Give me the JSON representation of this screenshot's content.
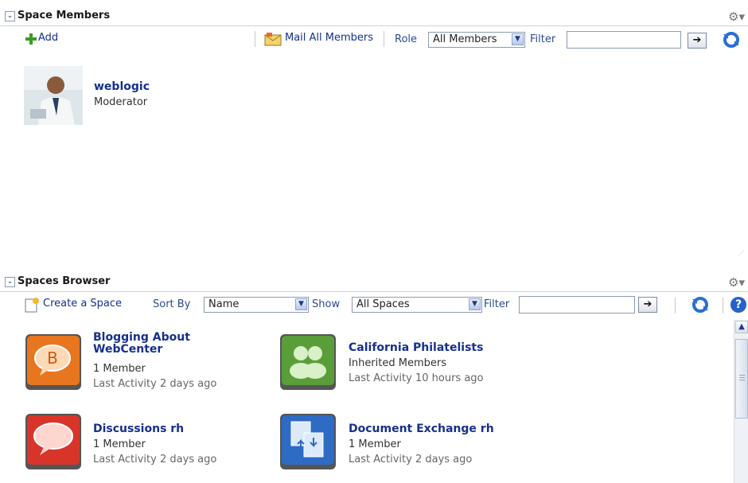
{
  "space_members": {
    "title": "Space Members",
    "add_label": "Add",
    "mail_all_label": "Mail All Members",
    "role_label": "Role",
    "role_selected": "All Members",
    "filter_label": "Filter",
    "filter_value": "",
    "members": [
      {
        "name": "weblogic",
        "role": "Moderator"
      }
    ]
  },
  "spaces_browser": {
    "title": "Spaces Browser",
    "create_label": "Create a Space",
    "sort_by_label": "Sort By",
    "sort_selected": "Name",
    "show_label": "Show",
    "show_selected": "All Spaces",
    "filter_label": "Filter",
    "filter_value": "",
    "spaces": [
      {
        "title_line1": "Blogging About",
        "title_line2": "WebCenter",
        "members": "1 Member",
        "activity": "Last Activity 2 days ago",
        "icon": "blog-icon",
        "color": "#e8761e"
      },
      {
        "title_line1": "California Philatelists",
        "title_line2": "",
        "members": "Inherited Members",
        "activity": "Last Activity 10 hours ago",
        "icon": "group-icon",
        "color": "#5a9e3a"
      },
      {
        "title_line1": "Discussions rh",
        "title_line2": "",
        "members": "1 Member",
        "activity": "Last Activity 2 days ago",
        "icon": "discussion-icon",
        "color": "#d8352a"
      },
      {
        "title_line1": "Document Exchange rh",
        "title_line2": "",
        "members": "1 Member",
        "activity": "Last Activity 2 days ago",
        "icon": "document-exchange-icon",
        "color": "#2d6bc4"
      }
    ]
  },
  "colors": {
    "link": "#16308b",
    "header_border": "#c6d2e2",
    "label_blue": "#2a4b8e"
  }
}
